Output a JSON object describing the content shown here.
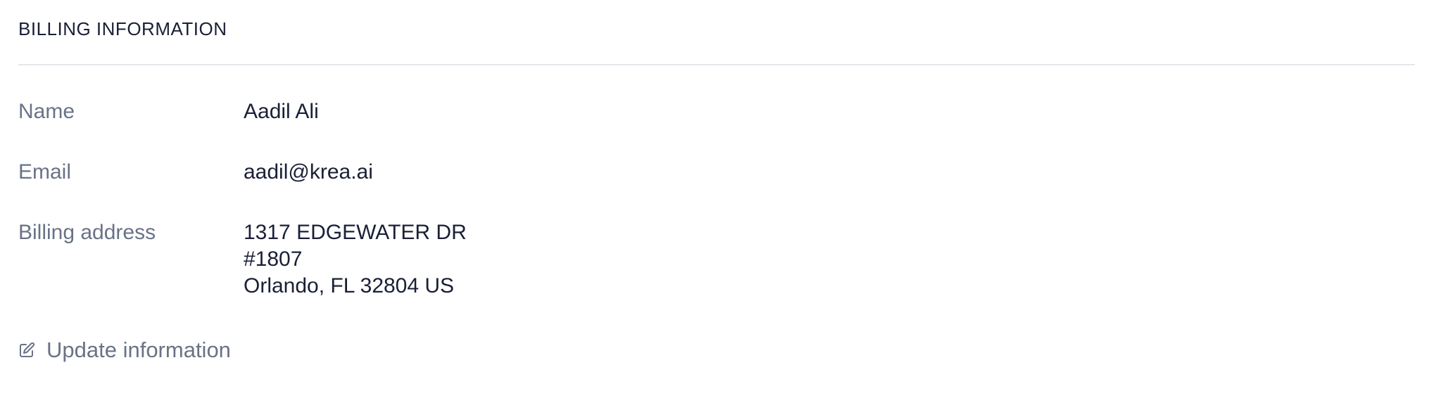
{
  "section": {
    "title": "BILLING INFORMATION"
  },
  "fields": {
    "name": {
      "label": "Name",
      "value": "Aadil Ali"
    },
    "email": {
      "label": "Email",
      "value": "aadil@krea.ai"
    },
    "address": {
      "label": "Billing address",
      "lines": [
        "1317 EDGEWATER DR",
        "#1807",
        "Orlando, FL 32804 US"
      ]
    }
  },
  "actions": {
    "update_label": "Update information",
    "update_icon": "edit-icon"
  },
  "colors": {
    "label": "#697386",
    "value": "#1a1f36",
    "divider": "#e3e6eb"
  }
}
